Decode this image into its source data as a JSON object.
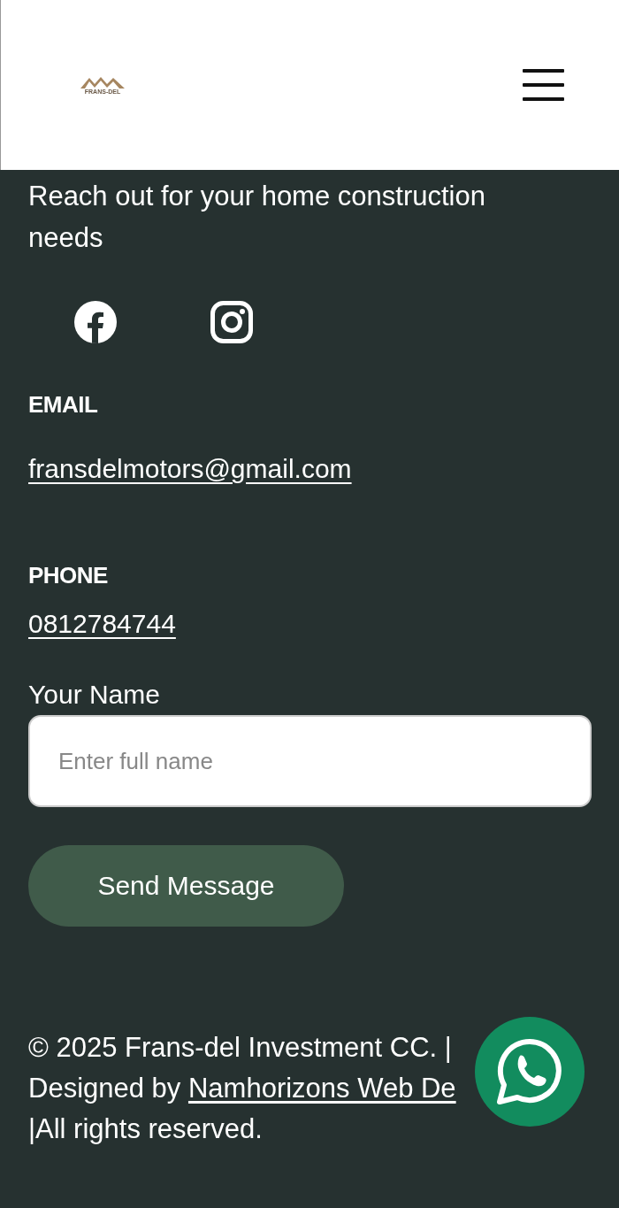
{
  "header": {
    "logo": {
      "text": "FRANS-DEL"
    }
  },
  "contact": {
    "tagline": "Reach out for your home construction needs",
    "social": [
      {
        "kind": "facebook"
      },
      {
        "kind": "instagram"
      }
    ],
    "email": {
      "label": "EMAIL",
      "value": "fransdelmotors@gmail.com"
    },
    "phone": {
      "label": "PHONE",
      "value": "0812784744"
    },
    "form": {
      "label": "Your Name",
      "placeholder": "Enter full name",
      "button": "Send Message"
    }
  },
  "footer": {
    "line_1": "© 2025 Frans-del Investment CC. |",
    "designed_by": "Designed by ",
    "link": "Namhorizons Web De",
    "line_3": "|All rights reserved."
  }
}
